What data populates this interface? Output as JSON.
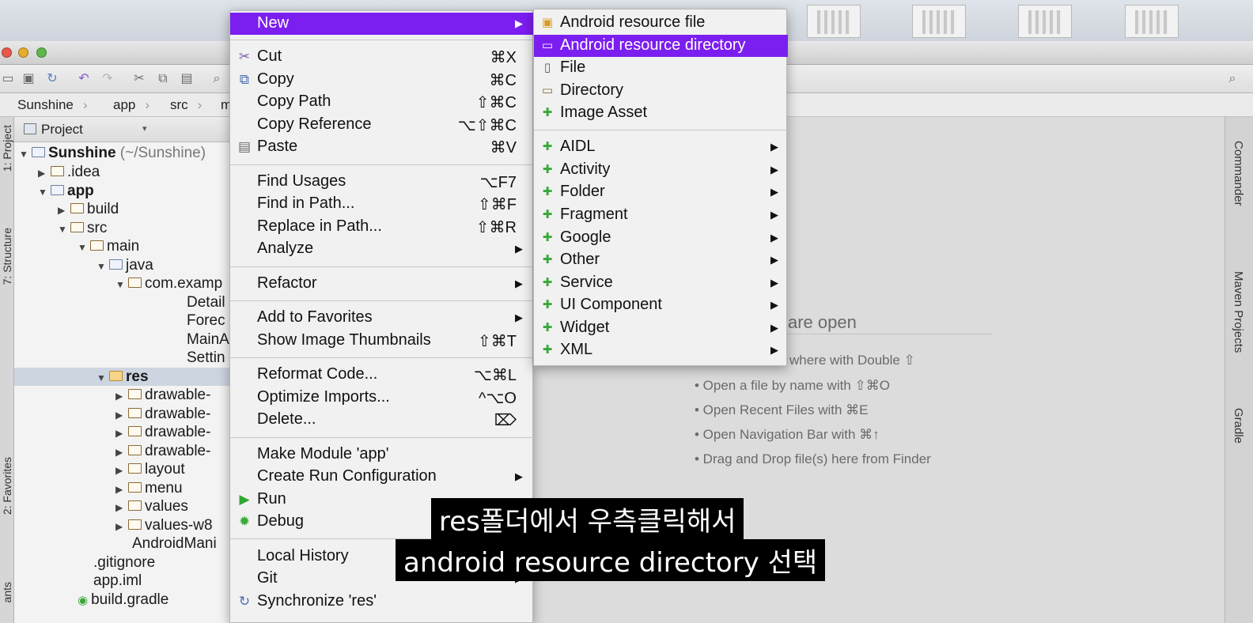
{
  "window": {
    "breadcrumbs": [
      "Sunshine",
      "app",
      "src",
      "m"
    ]
  },
  "left_tabs": [
    "1: Project",
    "7: Structure",
    "2: Favorites",
    "ants"
  ],
  "right_tabs": [
    "Commander",
    "Maven Projects",
    "Gradle"
  ],
  "project_panel": {
    "header": "Project",
    "tree": [
      {
        "name": "Sunshine",
        "suffix": " (~/Sunshine)",
        "bold": true
      },
      {
        "name": ".idea"
      },
      {
        "name": "app",
        "bold": true
      },
      {
        "name": "build"
      },
      {
        "name": "src"
      },
      {
        "name": "main"
      },
      {
        "name": "java"
      },
      {
        "name": "com.examp"
      },
      {
        "name": "Detail"
      },
      {
        "name": "Forec"
      },
      {
        "name": "MainA"
      },
      {
        "name": "Settin"
      },
      {
        "name": "res",
        "bold": true
      },
      {
        "name": "drawable-"
      },
      {
        "name": "drawable-"
      },
      {
        "name": "drawable-"
      },
      {
        "name": "drawable-"
      },
      {
        "name": "layout"
      },
      {
        "name": "menu"
      },
      {
        "name": "values"
      },
      {
        "name": "values-w8"
      },
      {
        "name": "AndroidMani"
      },
      {
        "name": ".gitignore"
      },
      {
        "name": "app.iml"
      },
      {
        "name": "build.gradle"
      }
    ]
  },
  "editor": {
    "hint_heading": "are open",
    "hints": [
      "where with Double ⇧",
      "• Open a file by name with ⇧⌘O",
      "• Open Recent Files with ⌘E",
      "• Open Navigation Bar with ⌘↑",
      "• Drag and Drop file(s) here from Finder"
    ]
  },
  "context_menu": {
    "items": [
      {
        "label": "New",
        "submenu": true,
        "highlighted": true
      },
      {
        "label": "Cut",
        "shortcut": "⌘X",
        "icon": "scissors-icon"
      },
      {
        "label": "Copy",
        "shortcut": "⌘C",
        "icon": "copy-icon"
      },
      {
        "label": "Copy Path",
        "shortcut": "⇧⌘C"
      },
      {
        "label": "Copy Reference",
        "shortcut": "⌥⇧⌘C"
      },
      {
        "label": "Paste",
        "shortcut": "⌘V",
        "icon": "paste-icon"
      },
      {
        "label": "Find Usages",
        "shortcut": "⌥F7"
      },
      {
        "label": "Find in Path...",
        "shortcut": "⇧⌘F"
      },
      {
        "label": "Replace in Path...",
        "shortcut": "⇧⌘R"
      },
      {
        "label": "Analyze",
        "submenu": true
      },
      {
        "label": "Refactor",
        "submenu": true
      },
      {
        "label": "Add to Favorites",
        "submenu": true
      },
      {
        "label": "Show Image Thumbnails",
        "shortcut": "⇧⌘T"
      },
      {
        "label": "Reformat Code...",
        "shortcut": "⌥⌘L"
      },
      {
        "label": "Optimize Imports...",
        "shortcut": "^⌥O"
      },
      {
        "label": "Delete...",
        "shortcut": "⌦"
      },
      {
        "label": "Make Module 'app'"
      },
      {
        "label": "Create Run Configuration",
        "submenu": true
      },
      {
        "label": "Run",
        "icon": "run-icon"
      },
      {
        "label": "Debug",
        "icon": "debug-icon"
      },
      {
        "label": "Local History",
        "submenu": true
      },
      {
        "label": "Git",
        "submenu": true
      },
      {
        "label": "Synchronize 'res'",
        "icon": "sync-icon"
      }
    ]
  },
  "new_submenu": {
    "items": [
      {
        "label": "Android resource file",
        "icon": "android-resource-file-icon"
      },
      {
        "label": "Android resource directory",
        "icon": "folder-icon",
        "highlighted": true
      },
      {
        "label": "File",
        "icon": "file-icon"
      },
      {
        "label": "Directory",
        "icon": "folder-icon"
      },
      {
        "label": "Image Asset",
        "icon": "android-icon"
      },
      {
        "label": "AIDL",
        "submenu": true
      },
      {
        "label": "Activity",
        "submenu": true
      },
      {
        "label": "Folder",
        "submenu": true
      },
      {
        "label": "Fragment",
        "submenu": true
      },
      {
        "label": "Google",
        "submenu": true
      },
      {
        "label": "Other",
        "submenu": true
      },
      {
        "label": "Service",
        "submenu": true
      },
      {
        "label": "UI Component",
        "submenu": true
      },
      {
        "label": "Widget",
        "submenu": true
      },
      {
        "label": "XML",
        "submenu": true
      }
    ]
  },
  "subtitles": [
    "res폴더에서 우측클릭해서",
    "android resource directory 선택"
  ],
  "colors": {
    "highlight": "#7b1ef0",
    "android_green": "#3aa83a"
  }
}
